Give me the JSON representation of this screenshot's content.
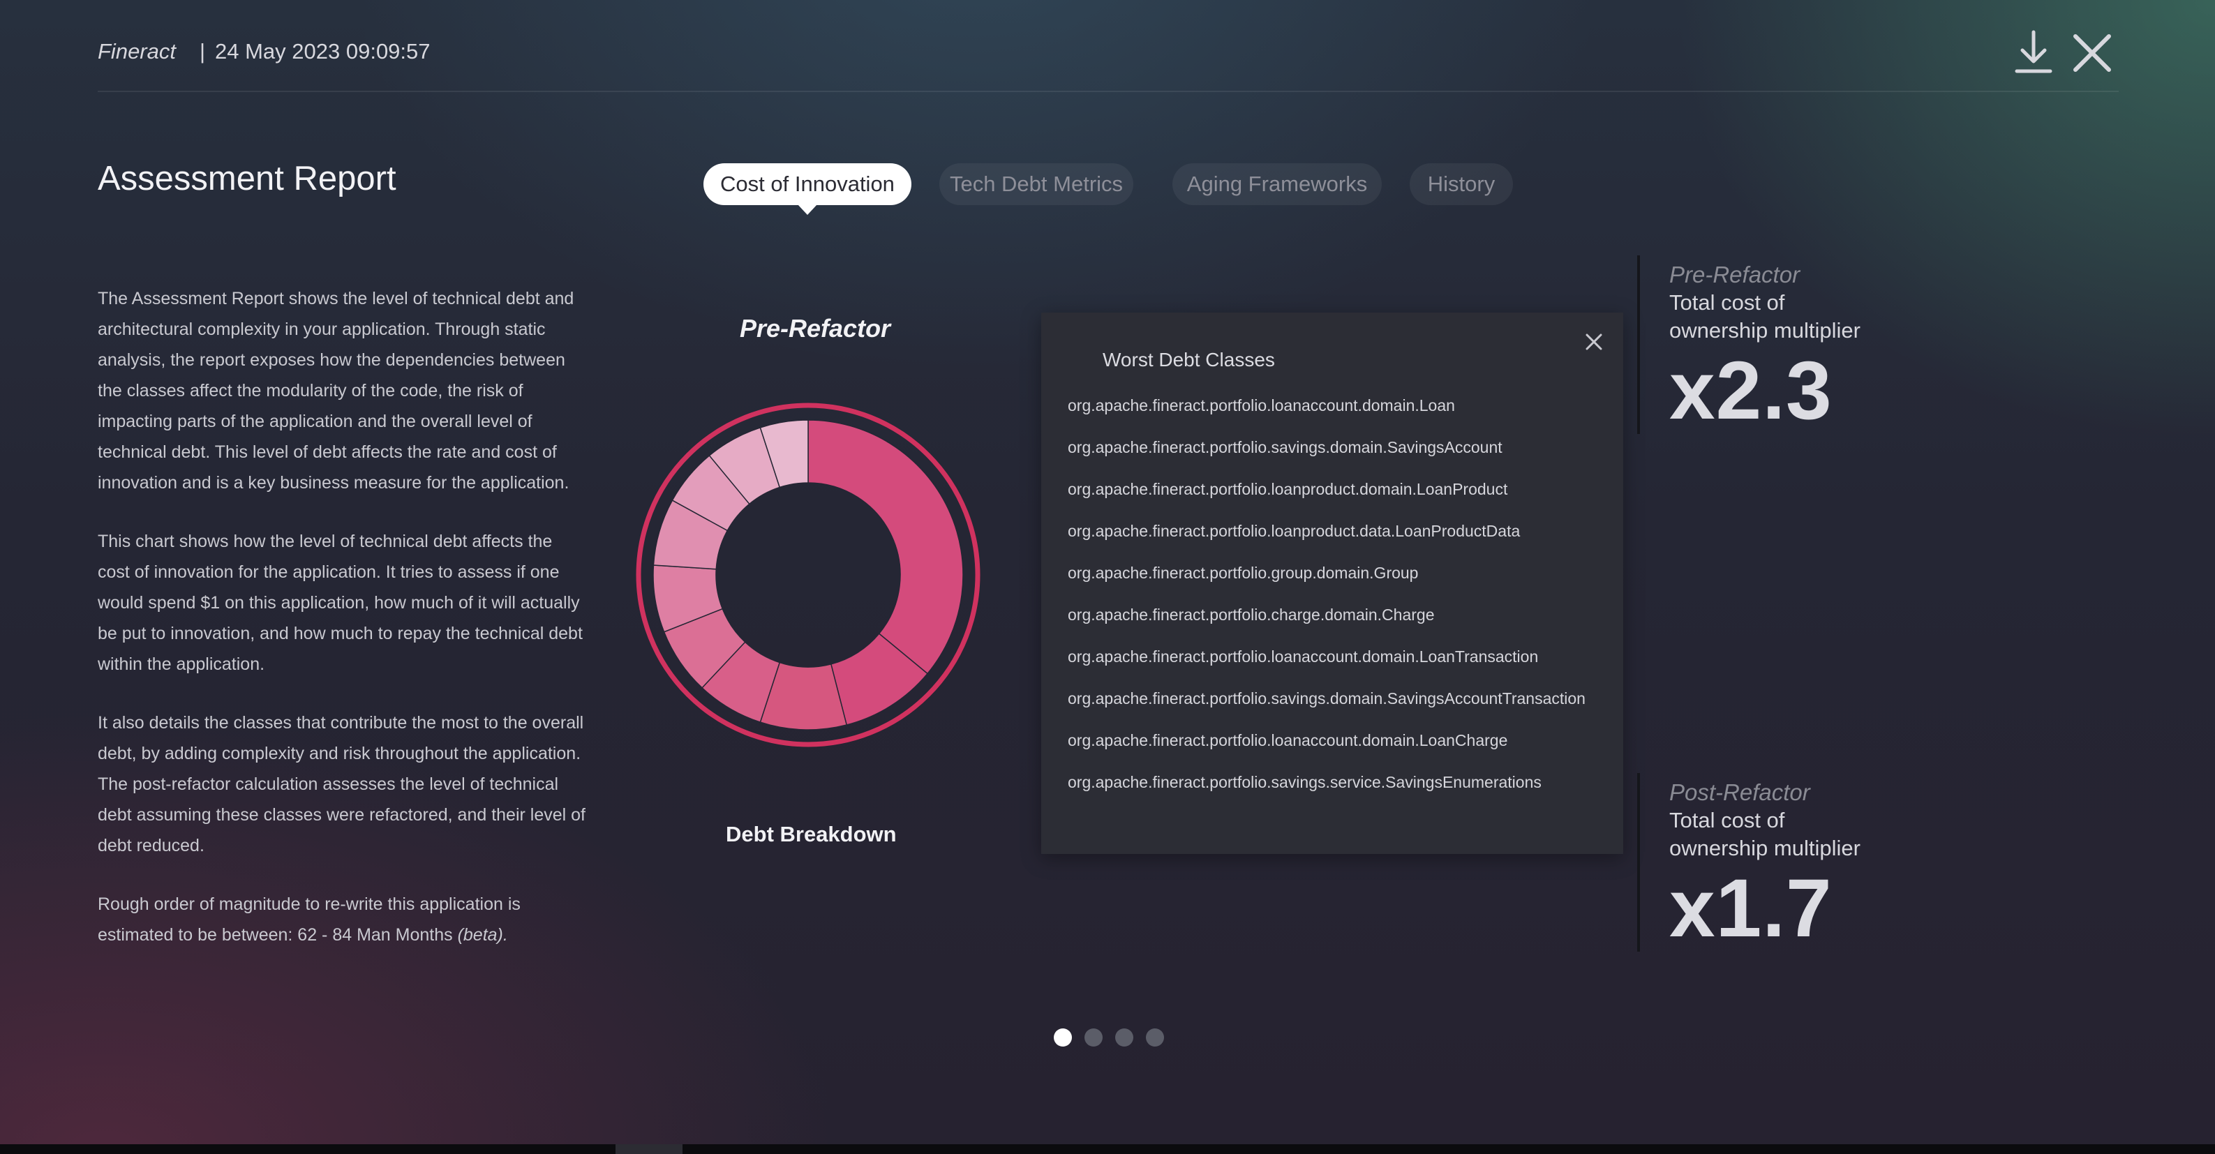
{
  "header": {
    "brand": "Fineract",
    "separator": "|",
    "timestamp": "24 May 2023 09:09:57",
    "icons": [
      "download-icon",
      "close-icon"
    ]
  },
  "page": {
    "title": "Assessment Report"
  },
  "tabs": [
    {
      "label": "Cost of Innovation",
      "active": true
    },
    {
      "label": "Tech Debt Metrics",
      "active": false
    },
    {
      "label": "Aging Frameworks",
      "active": false
    },
    {
      "label": "History",
      "active": false
    }
  ],
  "description": {
    "p1": "The Assessment Report shows the level of technical debt and architectural complexity in your application. Through static analysis, the report exposes how the dependencies between the classes affect the modularity of the code, the risk of impacting parts of the application and the overall level of technical debt. This level of debt affects the rate and cost of innovation and is a key business measure for the application.",
    "p2": "This chart shows how the level of technical debt affects the cost of innovation for the application. It tries to assess if one would spend $1 on this application, how much of it will actually be put to innovation, and how much to repay the technical debt within the application.",
    "p3": "It also details the classes that contribute the most to the overall debt, by adding complexity and risk throughout the application. The post-refactor calculation assesses the level of technical debt assuming these classes were refactored, and their level of debt reduced.",
    "p4_text": "Rough order of magnitude to re-write this application is estimated to be between: 62 - 84 Man Months ",
    "p4_beta": "(beta)."
  },
  "chart": {
    "title": "Pre-Refactor",
    "label": "Debt Breakdown",
    "colors": {
      "ring": "#d0325f",
      "segments": [
        "#d44b7c",
        "#d6577f",
        "#d85f89",
        "#db6f95",
        "#de7fa3",
        "#e08fb0",
        "#e39dbb",
        "#e6abc5",
        "#e8b9cf"
      ]
    }
  },
  "chart_data": {
    "type": "pie",
    "title": "Pre-Refactor",
    "values": [
      36,
      10,
      9,
      7,
      7,
      7,
      7,
      6,
      6,
      5
    ]
  },
  "worst_debt": {
    "title": "Worst Debt Classes",
    "classes": [
      "org.apache.fineract.portfolio.loanaccount.domain.Loan",
      "org.apache.fineract.portfolio.savings.domain.SavingsAccount",
      "org.apache.fineract.portfolio.loanproduct.domain.LoanProduct",
      "org.apache.fineract.portfolio.loanproduct.data.LoanProductData",
      "org.apache.fineract.portfolio.group.domain.Group",
      "org.apache.fineract.portfolio.charge.domain.Charge",
      "org.apache.fineract.portfolio.loanaccount.domain.LoanTransaction",
      "org.apache.fineract.portfolio.savings.domain.SavingsAccountTransaction",
      "org.apache.fineract.portfolio.loanaccount.domain.LoanCharge",
      "org.apache.fineract.portfolio.savings.service.SavingsEnumerations"
    ]
  },
  "metrics": {
    "pre": {
      "title": "Pre-Refactor",
      "subtitle1": "Total cost of",
      "subtitle2": "ownership multiplier",
      "value": "x2.3"
    },
    "post": {
      "title": "Post-Refactor",
      "subtitle1": "Total cost of",
      "subtitle2": "ownership multiplier",
      "value": "x1.7"
    }
  },
  "pagination": {
    "count": 4,
    "active_index": 0
  }
}
